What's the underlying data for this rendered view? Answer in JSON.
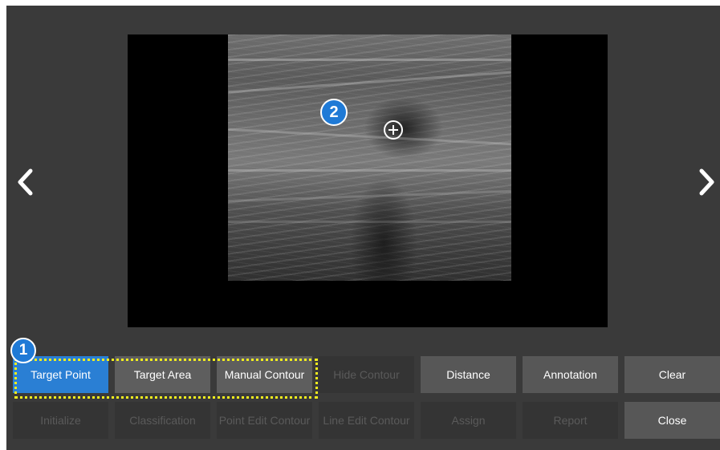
{
  "navigation": {
    "prev_icon": "chevron-left-icon",
    "next_icon": "chevron-right-icon"
  },
  "callouts": {
    "step1": "1",
    "step2": "2",
    "badge_color": "#1f7ad6",
    "highlight_color": "#f2ee1e"
  },
  "image_view": {
    "cursor_icon": "crosshair-plus-icon"
  },
  "toolbar": {
    "row1": [
      {
        "label": "Target Point",
        "state": "active"
      },
      {
        "label": "Target Area",
        "state": "enabled"
      },
      {
        "label": "Manual Contour",
        "state": "enabled"
      },
      {
        "label": "Hide Contour",
        "state": "disabled"
      },
      {
        "label": "Distance",
        "state": "enabled"
      },
      {
        "label": "Annotation",
        "state": "enabled"
      },
      {
        "label": "Clear",
        "state": "enabled"
      }
    ],
    "row2": [
      {
        "label": "Initialize",
        "state": "disabled"
      },
      {
        "label": "Classification",
        "state": "disabled"
      },
      {
        "label": "Point Edit Contour",
        "state": "disabled"
      },
      {
        "label": "Line Edit Contour",
        "state": "disabled"
      },
      {
        "label": "Assign",
        "state": "disabled"
      },
      {
        "label": "Report",
        "state": "disabled"
      },
      {
        "label": "Close",
        "state": "enabled"
      }
    ],
    "active_color": "#2a7fd4"
  }
}
